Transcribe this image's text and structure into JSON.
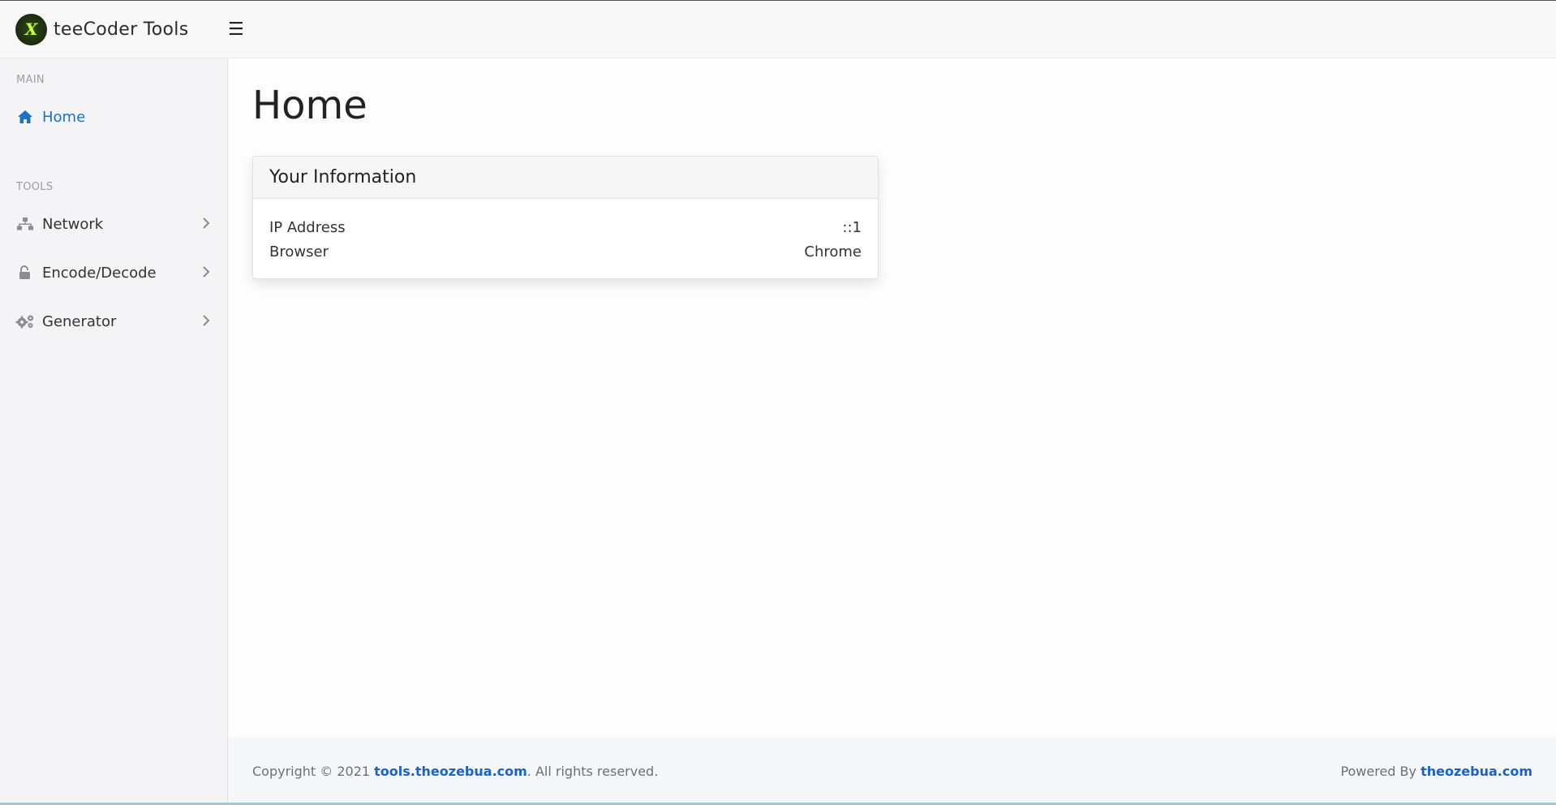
{
  "brand": {
    "logo_letter": "X",
    "name": "teeCoder Tools"
  },
  "topbar": {
    "menu_icon": "☰"
  },
  "sidebar": {
    "main_title": "MAIN",
    "tools_title": "TOOLS",
    "items": [
      {
        "label": "Home",
        "icon": "home-icon",
        "active": true
      },
      {
        "label": "Network",
        "icon": "network-icon"
      },
      {
        "label": "Encode/Decode",
        "icon": "lock-icon"
      },
      {
        "label": "Generator",
        "icon": "gears-icon"
      }
    ]
  },
  "main": {
    "title": "Home",
    "card": {
      "title": "Your Information",
      "rows": [
        {
          "label": "IP Address",
          "value": "::1"
        },
        {
          "label": "Browser",
          "value": "Chrome"
        }
      ]
    }
  },
  "footer": {
    "copyright_prefix": "Copyright © 2021 ",
    "copyright_link": "tools.theozebua.com",
    "copyright_suffix": ". All rights reserved.",
    "powered_prefix": "Powered By ",
    "powered_link": "theozebua.com"
  },
  "colors": {
    "accent": "#1a73c8",
    "link": "#1a63c4",
    "muted": "#9a9da2"
  }
}
